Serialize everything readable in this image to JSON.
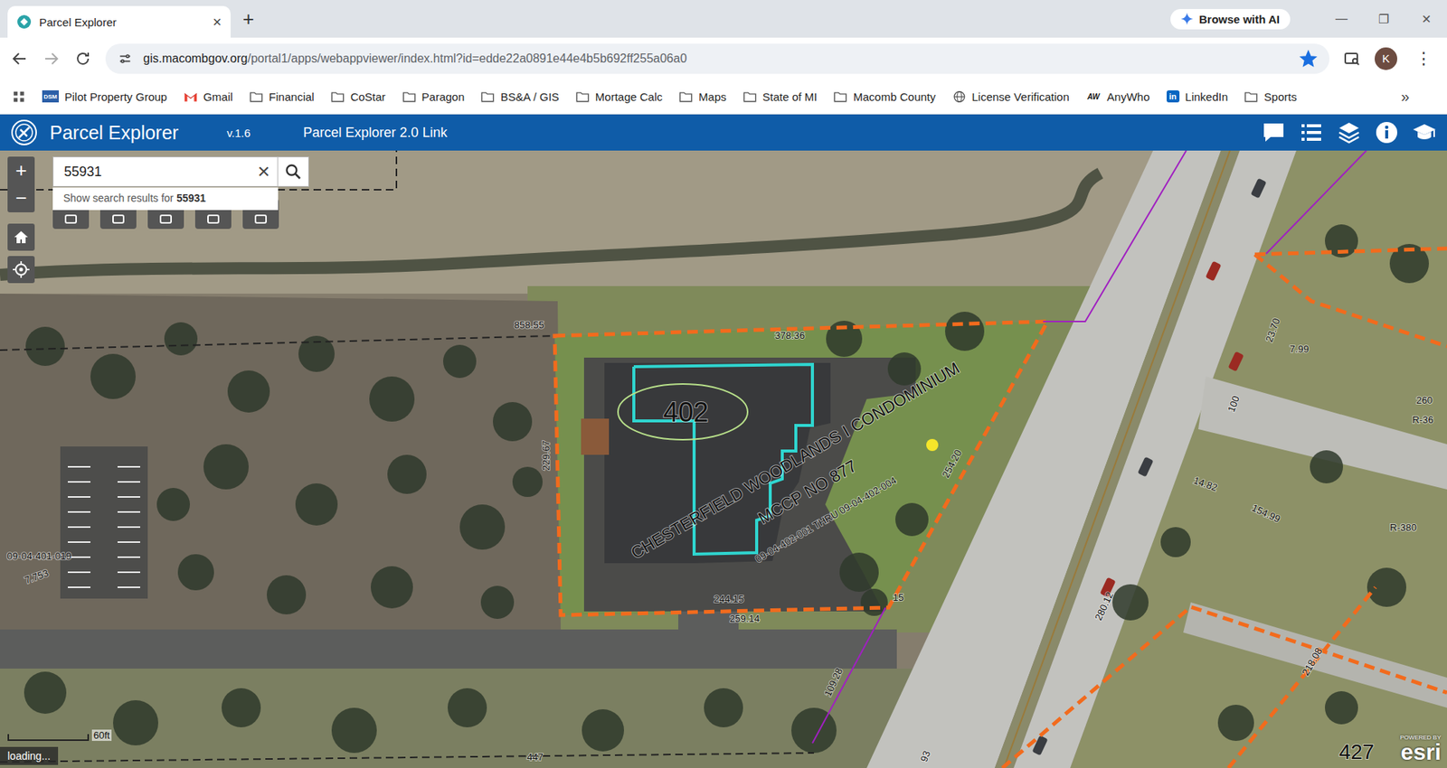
{
  "browser": {
    "tab": {
      "title": "Parcel Explorer",
      "close": "×"
    },
    "new_tab": "+",
    "ai_button": "Browse with AI",
    "window_controls": [
      "—",
      "❐",
      "✕"
    ],
    "url_domain": "gis.macombgov.org",
    "url_path": "/portal1/apps/webappviewer/index.html?id=edde22a0891e44e4b5b692ff255a06a0",
    "bookmarked": true,
    "profile": "K",
    "menu": "⋮"
  },
  "bookmarks": [
    {
      "label": "Pilot Property Group",
      "kind": "dsm",
      "badge": "DSM"
    },
    {
      "label": "Gmail",
      "kind": "gmail"
    },
    {
      "label": "Financial",
      "kind": "folder"
    },
    {
      "label": "CoStar",
      "kind": "folder"
    },
    {
      "label": "Paragon",
      "kind": "folder"
    },
    {
      "label": "BS&A / GIS",
      "kind": "folder"
    },
    {
      "label": "Mortage Calc",
      "kind": "folder"
    },
    {
      "label": "Maps",
      "kind": "folder"
    },
    {
      "label": "State of MI",
      "kind": "folder"
    },
    {
      "label": "Macomb County",
      "kind": "folder"
    },
    {
      "label": "License Verification",
      "kind": "globe"
    },
    {
      "label": "AnyWho",
      "kind": "aw",
      "badge": "AW"
    },
    {
      "label": "LinkedIn",
      "kind": "linkedin",
      "badge": "in"
    },
    {
      "label": "Sports",
      "kind": "folder"
    }
  ],
  "bookmarks_more": "»",
  "app": {
    "title": "Parcel Explorer",
    "version": "v.1.6",
    "link": "Parcel Explorer 2.0 Link"
  },
  "map": {
    "search": {
      "value": "55931",
      "clear": "×",
      "suggestion_prefix": "Show search results for ",
      "suggestion_term": "55931"
    },
    "zoom": [
      "+",
      "−"
    ],
    "scale": "60ft",
    "status": "loading...",
    "attribution": {
      "small": "POWERED BY",
      "brand": "esri"
    },
    "selected_parcel": "402",
    "labels": [
      {
        "text": "CHESTERFIELD WOODLANDS I CONDOMINIUM",
        "kind": "name"
      },
      {
        "text": "MCCP NO 877",
        "kind": "name"
      },
      {
        "text": "09-04-402-001 THRU 09-04-402-004",
        "kind": "id"
      },
      {
        "text": "858.55",
        "kind": "dimension"
      },
      {
        "text": "378.36",
        "kind": "dimension"
      },
      {
        "text": "229.67",
        "kind": "dimension"
      },
      {
        "text": "254.20",
        "kind": "dimension"
      },
      {
        "text": "244.15",
        "kind": "dimension"
      },
      {
        "text": "259.14",
        "kind": "dimension"
      },
      {
        "text": "15",
        "kind": "dimension"
      },
      {
        "text": "09-04-401-019",
        "kind": "id"
      },
      {
        "text": "7.753",
        "kind": "dimension"
      },
      {
        "text": "100",
        "kind": "dimension"
      },
      {
        "text": "23.70",
        "kind": "dimension"
      },
      {
        "text": "7.99",
        "kind": "dimension"
      },
      {
        "text": "260",
        "kind": "dimension"
      },
      {
        "text": "R-36",
        "kind": "dimension"
      },
      {
        "text": "R-380",
        "kind": "dimension"
      },
      {
        "text": "14.82",
        "kind": "dimension"
      },
      {
        "text": "154.99",
        "kind": "dimension"
      },
      {
        "text": "280.12",
        "kind": "dimension"
      },
      {
        "text": "218.08",
        "kind": "dimension"
      },
      {
        "text": "109.28",
        "kind": "dimension"
      },
      {
        "text": "447",
        "kind": "dimension"
      },
      {
        "text": "93",
        "kind": "dimension"
      },
      {
        "text": "427",
        "kind": "big"
      }
    ]
  }
}
